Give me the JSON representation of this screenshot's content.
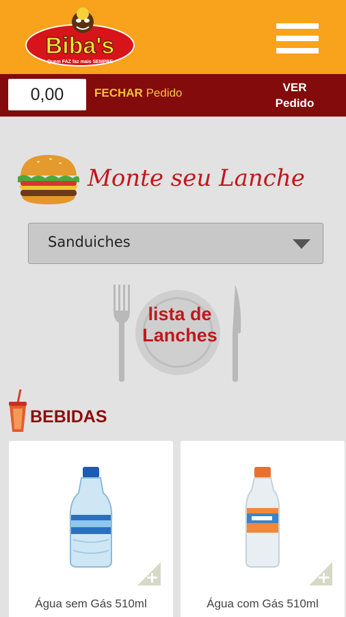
{
  "header": {
    "logo_text": "Biba's",
    "logo_tagline": "Quem FAZ faz mais SEMPRE"
  },
  "order_bar": {
    "total": "0,00",
    "close_strong": "FECHAR",
    "close_rest": " Pedido",
    "view_line1": "VER",
    "view_line2": "Pedido"
  },
  "builder": {
    "title": "Monte seu Lanche",
    "category_selected": "Sanduiches",
    "list_line1": "lista de",
    "list_line2": "Lanches"
  },
  "drinks": {
    "title": "BEBIDAS",
    "items": [
      {
        "name": "Água sem Gás 510ml",
        "cap_color": "#1a5bb5"
      },
      {
        "name": "Água com Gás 510ml",
        "cap_color": "#e8702a"
      }
    ]
  },
  "colors": {
    "topbar": "#f9a21b",
    "orderbar": "#830b0b",
    "accent_red": "#c0181c"
  }
}
